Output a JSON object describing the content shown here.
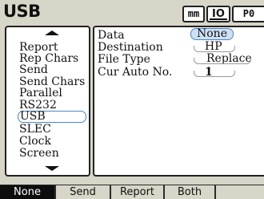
{
  "screen": {
    "title": "USB"
  },
  "status": {
    "units": "mm",
    "io_indicator": "IO",
    "preset": "P0"
  },
  "menu": {
    "items": [
      {
        "label": "Report",
        "selected": false
      },
      {
        "label": "Rep Chars",
        "selected": false
      },
      {
        "label": "Send",
        "selected": false
      },
      {
        "label": "Send Chars",
        "selected": false
      },
      {
        "label": "Parallel",
        "selected": false
      },
      {
        "label": "RS232",
        "selected": false
      },
      {
        "label": "USB",
        "selected": true
      },
      {
        "label": "SLEC",
        "selected": false
      },
      {
        "label": "Clock",
        "selected": false
      },
      {
        "label": "Screen",
        "selected": false
      }
    ]
  },
  "settings": {
    "fields": [
      {
        "label": "Data",
        "value": "None"
      },
      {
        "label": "Destination",
        "value": "HP"
      },
      {
        "label": "File Type",
        "value": "Replace"
      },
      {
        "label": "Cur Auto No.",
        "value": "1"
      }
    ]
  },
  "softkeys": [
    {
      "label": "None",
      "active": true
    },
    {
      "label": "Send",
      "active": false
    },
    {
      "label": "Report",
      "active": false
    },
    {
      "label": "Both",
      "active": false
    },
    {
      "label": "",
      "active": false
    }
  ],
  "colors": {
    "background": "#d8d6c8",
    "selection_outline": "#4a86c8",
    "selection_fill": "#cfe0f4",
    "softkey_active": "#0d0d0d"
  }
}
